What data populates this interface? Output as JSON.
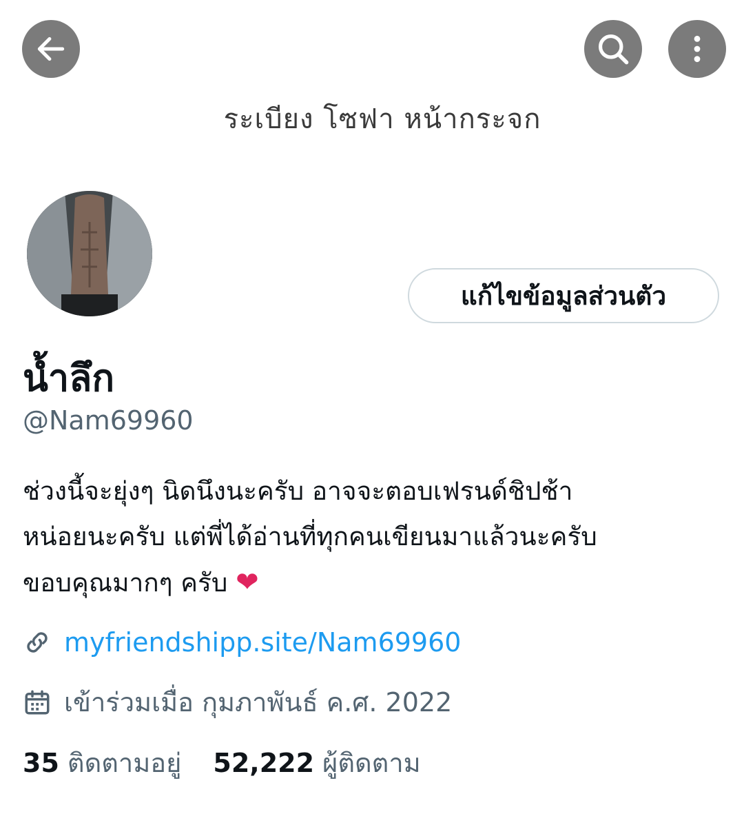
{
  "header": {
    "cover_text": "ระเบียง โซฟา หน้ากระจก"
  },
  "profile": {
    "edit_button_label": "แก้ไขข้อมูลส่วนตัว",
    "display_name": "น้ำลึก",
    "handle": "@Nam69960",
    "bio_lines": [
      "ช่วงนี้จะยุ่งๆ นิดนึงนะครับ อาจจะตอบเฟรนด์ชิปช้า",
      "หน่อยนะครับ แต่พี่ได้อ่านที่ทุกคนเขียนมาแล้วนะครับ",
      "ขอบคุณมากๆ ครับ"
    ],
    "bio_emoji": "❤",
    "link": "myfriendshipp.site/Nam69960",
    "joined": "เข้าร่วมเมื่อ กุมภาพันธ์ ค.ศ. 2022",
    "following_count": "35",
    "following_label": "ติดตามอยู่",
    "followers_count": "52,222",
    "followers_label": "ผู้ติดตาม"
  },
  "icons": {
    "back": "arrow-left-icon",
    "search": "search-icon",
    "more": "more-vertical-icon",
    "link": "link-icon",
    "calendar": "calendar-icon"
  },
  "colors": {
    "link": "#1d9bf0",
    "secondary_text": "#536471",
    "overlay_button": "#7b7b7b",
    "heart": "#e0245e"
  }
}
